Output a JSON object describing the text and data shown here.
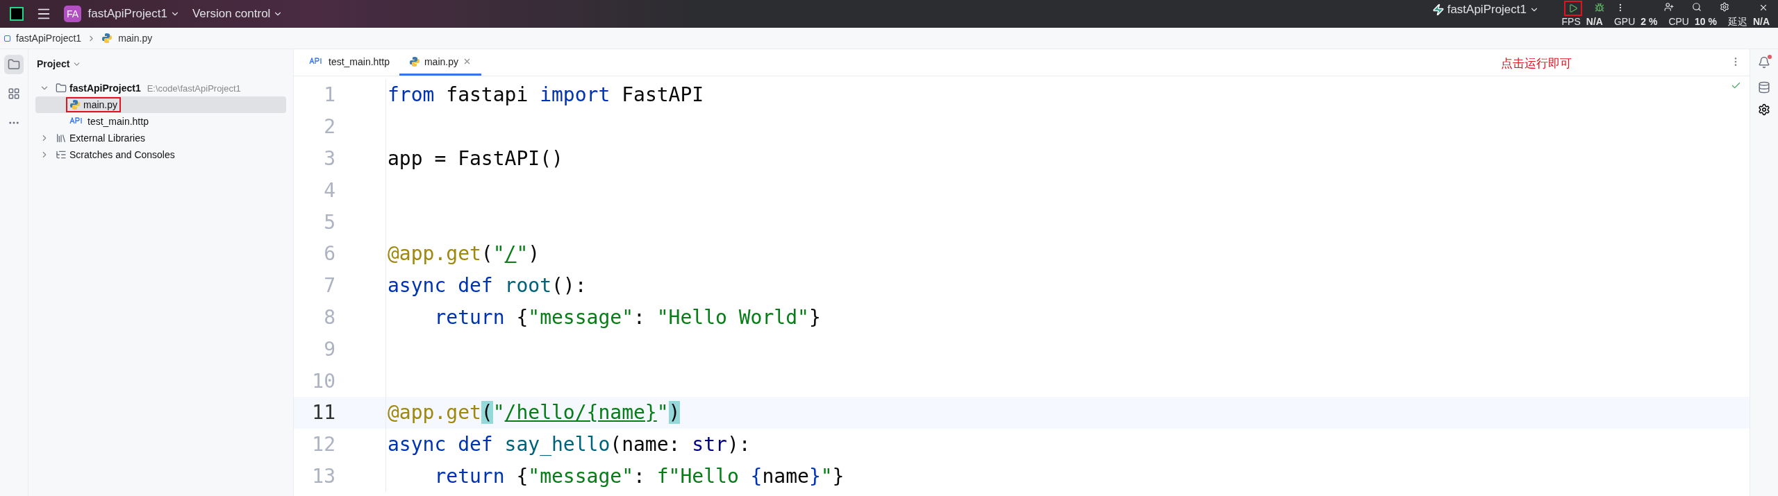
{
  "title_bar": {
    "project_badge": "FA",
    "project": "fastApiProject1",
    "vcs": "Version control",
    "run_config": "fastApiProject1",
    "run_button": {
      "annotated": true
    },
    "overlay": [
      {
        "label": "FPS",
        "value": "N/A"
      },
      {
        "label": "GPU",
        "value": "2 %"
      },
      {
        "label": "CPU",
        "value": "10 %"
      },
      {
        "label": "延迟",
        "value": "N/A"
      }
    ]
  },
  "breadcrumbs": [
    "fastApiProject1",
    "main.py"
  ],
  "project_panel": {
    "title": "Project",
    "tree": [
      {
        "label": "fastApiProject1",
        "hint": "E:\\code\\fastApiProject1",
        "kind": "folder",
        "expanded": true,
        "selected": false,
        "annotated": false,
        "children": [
          {
            "label": "main.py",
            "kind": "python",
            "selected": true,
            "annotated": true
          },
          {
            "label": "test_main.http",
            "kind": "http",
            "selected": false,
            "annotated": false
          }
        ]
      },
      {
        "label": "External Libraries",
        "kind": "library",
        "expanded": false,
        "selected": false,
        "annotated": false
      },
      {
        "label": "Scratches and Consoles",
        "kind": "scratch",
        "expanded": false,
        "selected": false,
        "annotated": false
      }
    ]
  },
  "tabs": [
    {
      "label": "test_main.http",
      "kind": "http",
      "selected": false
    },
    {
      "label": "main.py",
      "kind": "python",
      "selected": true
    }
  ],
  "annotation": "点击运行即可",
  "code": [
    {
      "n": "1",
      "current": false,
      "tokens": [
        {
          "text": "from",
          "kind": "keyword"
        },
        {
          "text": " fastapi ",
          "kind": "plain"
        },
        {
          "text": "import",
          "kind": "keyword"
        },
        {
          "text": " FastAPI",
          "kind": "plain"
        }
      ]
    },
    {
      "n": "2",
      "current": false
    },
    {
      "n": "3",
      "current": false,
      "tokens": [
        {
          "text": "app = FastAPI()",
          "kind": "plain"
        }
      ]
    },
    {
      "n": "4",
      "current": false
    },
    {
      "n": "5",
      "current": false
    },
    {
      "n": "6",
      "current": false,
      "tokens": [
        {
          "text": "@app.get",
          "kind": "decorator"
        },
        {
          "text": "(",
          "kind": "plain"
        },
        {
          "text": "\"",
          "kind": "string"
        },
        {
          "text": "/",
          "kind": "url"
        },
        {
          "text": "\"",
          "kind": "string"
        },
        {
          "text": ")",
          "kind": "plain"
        }
      ]
    },
    {
      "n": "7",
      "current": false,
      "tokens": [
        {
          "text": "async def ",
          "kind": "keyword"
        },
        {
          "text": "root",
          "kind": "function"
        },
        {
          "text": "():",
          "kind": "plain"
        }
      ]
    },
    {
      "n": "8",
      "current": false,
      "tokens": [
        {
          "text": "    return ",
          "kind": "keyword"
        },
        {
          "text": "{",
          "kind": "plain"
        },
        {
          "text": "\"message\"",
          "kind": "string"
        },
        {
          "text": ": ",
          "kind": "plain"
        },
        {
          "text": "\"Hello World\"",
          "kind": "string"
        },
        {
          "text": "}",
          "kind": "plain"
        }
      ]
    },
    {
      "n": "9",
      "current": false
    },
    {
      "n": "10",
      "current": false
    },
    {
      "n": "11",
      "current": true,
      "tokens": [
        {
          "text": "@app.get",
          "kind": "decorator"
        },
        {
          "text": "(",
          "kind": "match"
        },
        {
          "text": "\"",
          "kind": "string"
        },
        {
          "text": "/hello/{name}",
          "kind": "url"
        },
        {
          "text": "\"",
          "kind": "string"
        },
        {
          "text": ")",
          "kind": "match"
        }
      ]
    },
    {
      "n": "12",
      "current": false,
      "tokens": [
        {
          "text": "async def ",
          "kind": "keyword"
        },
        {
          "text": "say_hello",
          "kind": "function"
        },
        {
          "text": "(name: ",
          "kind": "plain"
        },
        {
          "text": "str",
          "kind": "builtin"
        },
        {
          "text": "):",
          "kind": "plain"
        }
      ]
    },
    {
      "n": "13",
      "current": false,
      "tokens": [
        {
          "text": "    return ",
          "kind": "keyword"
        },
        {
          "text": "{",
          "kind": "plain"
        },
        {
          "text": "\"message\"",
          "kind": "string"
        },
        {
          "text": ": ",
          "kind": "plain"
        },
        {
          "text": "f\"Hello ",
          "kind": "string"
        },
        {
          "text": "{",
          "kind": "keyword"
        },
        {
          "text": "name",
          "kind": "plain"
        },
        {
          "text": "}",
          "kind": "keyword"
        },
        {
          "text": "\"",
          "kind": "string"
        },
        {
          "text": "}",
          "kind": "plain"
        }
      ]
    }
  ]
}
